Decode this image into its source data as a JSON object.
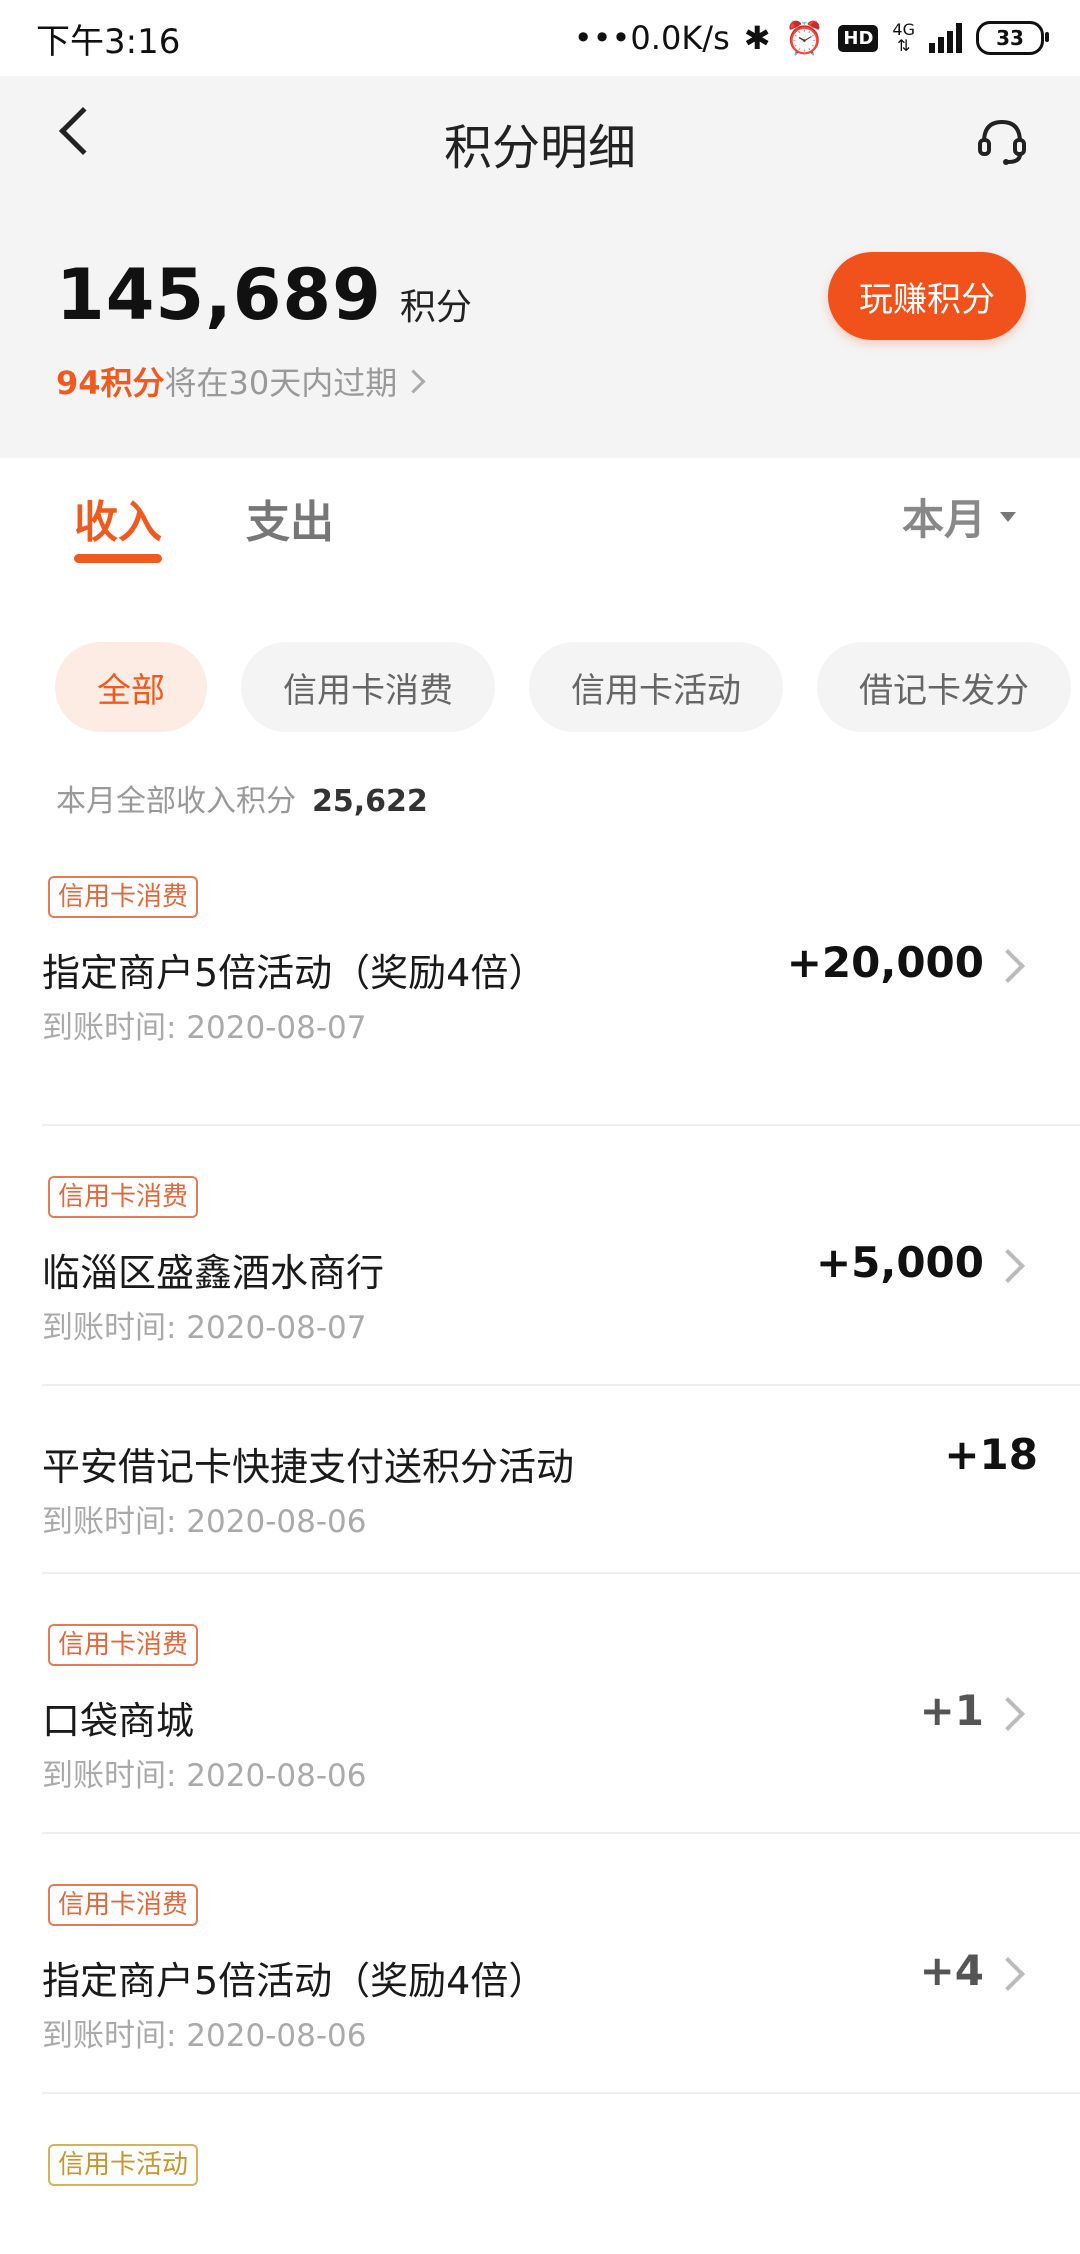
{
  "status_bar": {
    "time": "下午3:16",
    "network_speed": "0.0K/s",
    "network_type": "4G",
    "hd_label": "HD",
    "battery": "33"
  },
  "header": {
    "title": "积分明细",
    "points_value": "145,689",
    "points_unit": "积分",
    "expire_highlight": "94积分",
    "expire_text": "将在30天内过期",
    "earn_button": "玩赚积分"
  },
  "tabs": {
    "income": "收入",
    "expense": "支出",
    "period": "本月"
  },
  "chips": [
    "全部",
    "信用卡消费",
    "信用卡活动",
    "借记卡发分"
  ],
  "summary": {
    "label": "本月全部收入积分",
    "value": "25,622"
  },
  "records": [
    {
      "tag": "信用卡消费",
      "title": "指定商户5倍活动（奖励4倍）",
      "time": "到账时间: 2020-08-07",
      "amount": "+20,000"
    },
    {
      "tag": "信用卡消费",
      "title": "临淄区盛鑫酒水商行",
      "time": "到账时间: 2020-08-07",
      "amount": "+5,000"
    },
    {
      "tag": "",
      "title": "平安借记卡快捷支付送积分活动",
      "time": "到账时间: 2020-08-06",
      "amount": "+18"
    },
    {
      "tag": "信用卡消费",
      "title": "口袋商城",
      "time": "到账时间: 2020-08-06",
      "amount": "+1"
    },
    {
      "tag": "信用卡消费",
      "title": "指定商户5倍活动（奖励4倍）",
      "time": "到账时间: 2020-08-06",
      "amount": "+4"
    },
    {
      "tag": "信用卡活动",
      "title": "",
      "time": "",
      "amount": ""
    }
  ],
  "colors": {
    "accent": "#f05a1e",
    "button": "#f1521b",
    "header_bg": "#f4f4f4",
    "tag_gold": "#c8962f"
  }
}
